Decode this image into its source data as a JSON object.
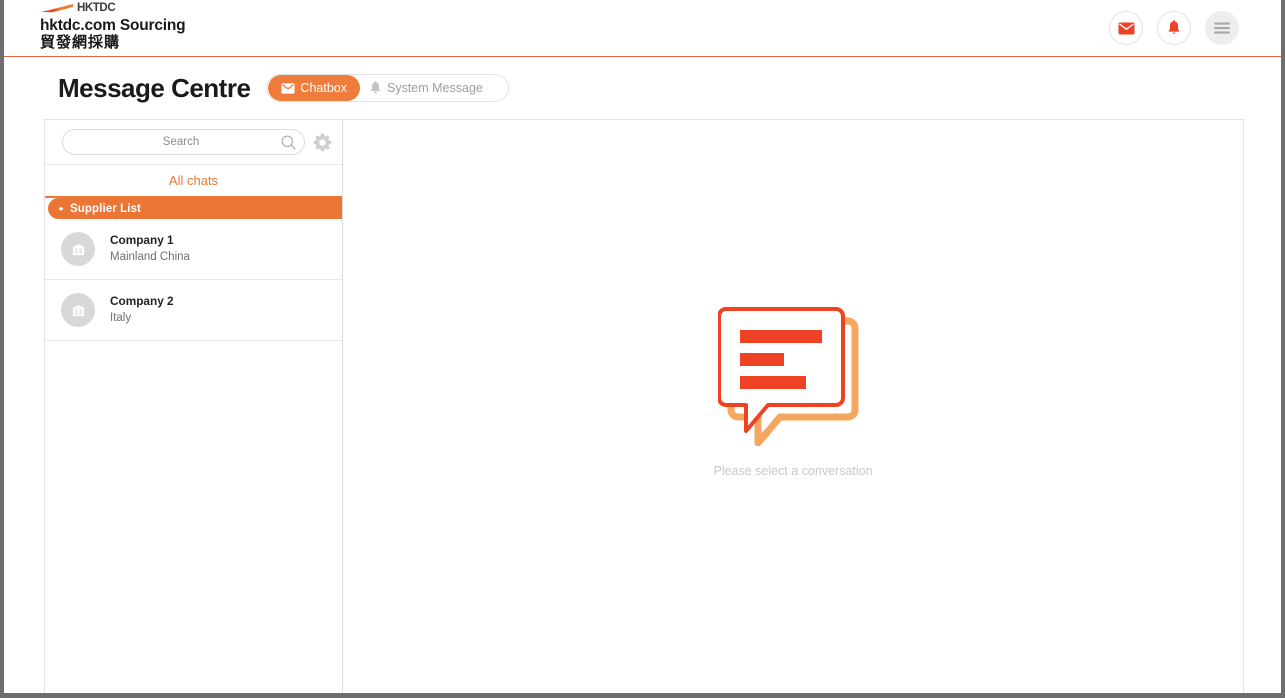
{
  "header": {
    "logo_word": "HKTDC",
    "logo_icon": "hktdc-swoosh-logo",
    "brand_en": "hktdc.com Sourcing",
    "brand_zh": "貿發網採購",
    "icons": [
      {
        "name": "mail-icon",
        "glyph": "envelope"
      },
      {
        "name": "notification-bell-icon",
        "glyph": "bell"
      },
      {
        "name": "hamburger-menu-icon",
        "glyph": "menu"
      }
    ],
    "accent_color": "#ea7534",
    "icon_color": "#ef4123"
  },
  "page": {
    "title": "Message Centre",
    "tabs": [
      {
        "label": "Chatbox",
        "icon": "envelope-icon",
        "active": true
      },
      {
        "label": "System Message",
        "icon": "bell-icon",
        "active": false
      }
    ]
  },
  "sidebar": {
    "search": {
      "placeholder": "Search",
      "value": "",
      "search_icon": "magnifier-icon",
      "settings_icon": "gear-icon"
    },
    "filter_tab": "All chats",
    "group_header": "Supplier List",
    "chats": [
      {
        "name": "Company 1",
        "location": "Mainland China",
        "avatar": "company-building-icon"
      },
      {
        "name": "Company 2",
        "location": "Italy",
        "avatar": "company-building-icon"
      }
    ]
  },
  "main": {
    "empty_caption": "Please select a conversation",
    "illustration": "speech-bubble-illustration",
    "illustration_colors": {
      "primary": "#ef4123",
      "shadow": "#f6a75f"
    }
  }
}
